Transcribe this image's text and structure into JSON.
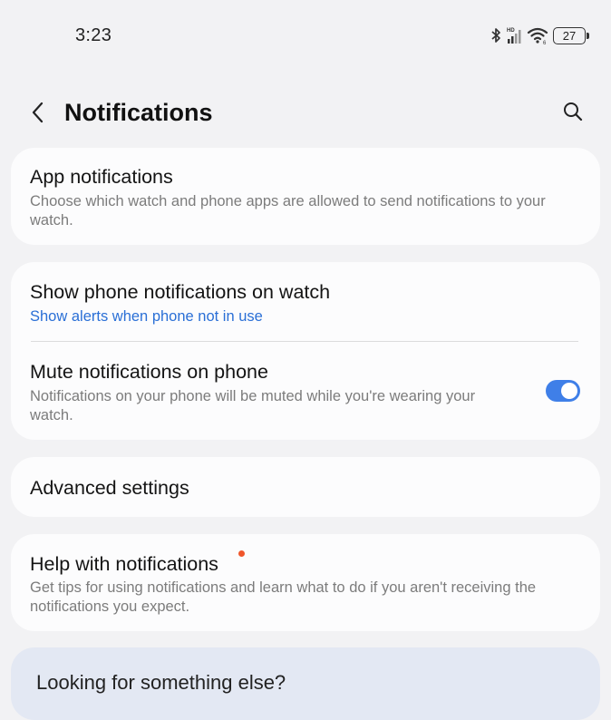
{
  "status_bar": {
    "time": "3:23",
    "battery_level": "27",
    "icons": [
      "bluetooth-icon",
      "signal-hd-icon",
      "wifi-icon",
      "battery-icon"
    ]
  },
  "header": {
    "title": "Notifications",
    "back_icon": "chevron-left-icon",
    "search_icon": "search-icon"
  },
  "sections": {
    "app_notifications": {
      "title": "App notifications",
      "subtitle": "Choose which watch and phone apps are allowed to send notifications to your watch."
    },
    "show_phone_notifications": {
      "title": "Show phone notifications on watch",
      "subtitle": "Show alerts when phone not in use"
    },
    "mute_notifications": {
      "title": "Mute notifications on phone",
      "subtitle": "Notifications on your phone will be muted while you're wearing your watch.",
      "enabled": true
    },
    "advanced_settings": {
      "title": "Advanced settings"
    },
    "help": {
      "title": "Help with notifications",
      "subtitle": "Get tips for using notifications and learn what to do if you aren't receiving the notifications you expect.",
      "has_new_badge": true
    },
    "looking_for": {
      "title": "Looking for something else?"
    }
  },
  "colors": {
    "background": "#f2f2f4",
    "card": "#fcfcfd",
    "accent": "#3f7fe8",
    "link": "#2a6fd6",
    "badge": "#f0562b"
  }
}
